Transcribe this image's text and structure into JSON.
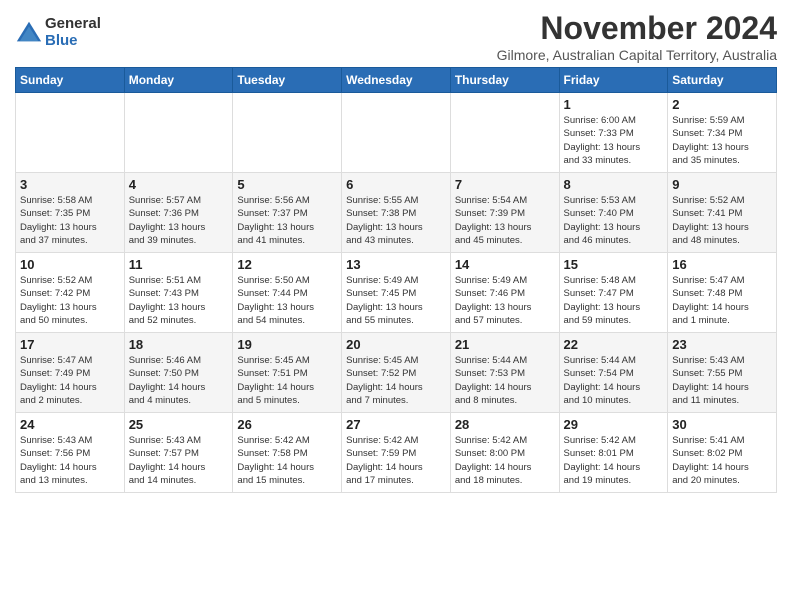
{
  "header": {
    "logo_general": "General",
    "logo_blue": "Blue",
    "month_title": "November 2024",
    "location": "Gilmore, Australian Capital Territory, Australia"
  },
  "days_of_week": [
    "Sunday",
    "Monday",
    "Tuesday",
    "Wednesday",
    "Thursday",
    "Friday",
    "Saturday"
  ],
  "weeks": [
    [
      {
        "day": "",
        "info": ""
      },
      {
        "day": "",
        "info": ""
      },
      {
        "day": "",
        "info": ""
      },
      {
        "day": "",
        "info": ""
      },
      {
        "day": "",
        "info": ""
      },
      {
        "day": "1",
        "info": "Sunrise: 6:00 AM\nSunset: 7:33 PM\nDaylight: 13 hours\nand 33 minutes."
      },
      {
        "day": "2",
        "info": "Sunrise: 5:59 AM\nSunset: 7:34 PM\nDaylight: 13 hours\nand 35 minutes."
      }
    ],
    [
      {
        "day": "3",
        "info": "Sunrise: 5:58 AM\nSunset: 7:35 PM\nDaylight: 13 hours\nand 37 minutes."
      },
      {
        "day": "4",
        "info": "Sunrise: 5:57 AM\nSunset: 7:36 PM\nDaylight: 13 hours\nand 39 minutes."
      },
      {
        "day": "5",
        "info": "Sunrise: 5:56 AM\nSunset: 7:37 PM\nDaylight: 13 hours\nand 41 minutes."
      },
      {
        "day": "6",
        "info": "Sunrise: 5:55 AM\nSunset: 7:38 PM\nDaylight: 13 hours\nand 43 minutes."
      },
      {
        "day": "7",
        "info": "Sunrise: 5:54 AM\nSunset: 7:39 PM\nDaylight: 13 hours\nand 45 minutes."
      },
      {
        "day": "8",
        "info": "Sunrise: 5:53 AM\nSunset: 7:40 PM\nDaylight: 13 hours\nand 46 minutes."
      },
      {
        "day": "9",
        "info": "Sunrise: 5:52 AM\nSunset: 7:41 PM\nDaylight: 13 hours\nand 48 minutes."
      }
    ],
    [
      {
        "day": "10",
        "info": "Sunrise: 5:52 AM\nSunset: 7:42 PM\nDaylight: 13 hours\nand 50 minutes."
      },
      {
        "day": "11",
        "info": "Sunrise: 5:51 AM\nSunset: 7:43 PM\nDaylight: 13 hours\nand 52 minutes."
      },
      {
        "day": "12",
        "info": "Sunrise: 5:50 AM\nSunset: 7:44 PM\nDaylight: 13 hours\nand 54 minutes."
      },
      {
        "day": "13",
        "info": "Sunrise: 5:49 AM\nSunset: 7:45 PM\nDaylight: 13 hours\nand 55 minutes."
      },
      {
        "day": "14",
        "info": "Sunrise: 5:49 AM\nSunset: 7:46 PM\nDaylight: 13 hours\nand 57 minutes."
      },
      {
        "day": "15",
        "info": "Sunrise: 5:48 AM\nSunset: 7:47 PM\nDaylight: 13 hours\nand 59 minutes."
      },
      {
        "day": "16",
        "info": "Sunrise: 5:47 AM\nSunset: 7:48 PM\nDaylight: 14 hours\nand 1 minute."
      }
    ],
    [
      {
        "day": "17",
        "info": "Sunrise: 5:47 AM\nSunset: 7:49 PM\nDaylight: 14 hours\nand 2 minutes."
      },
      {
        "day": "18",
        "info": "Sunrise: 5:46 AM\nSunset: 7:50 PM\nDaylight: 14 hours\nand 4 minutes."
      },
      {
        "day": "19",
        "info": "Sunrise: 5:45 AM\nSunset: 7:51 PM\nDaylight: 14 hours\nand 5 minutes."
      },
      {
        "day": "20",
        "info": "Sunrise: 5:45 AM\nSunset: 7:52 PM\nDaylight: 14 hours\nand 7 minutes."
      },
      {
        "day": "21",
        "info": "Sunrise: 5:44 AM\nSunset: 7:53 PM\nDaylight: 14 hours\nand 8 minutes."
      },
      {
        "day": "22",
        "info": "Sunrise: 5:44 AM\nSunset: 7:54 PM\nDaylight: 14 hours\nand 10 minutes."
      },
      {
        "day": "23",
        "info": "Sunrise: 5:43 AM\nSunset: 7:55 PM\nDaylight: 14 hours\nand 11 minutes."
      }
    ],
    [
      {
        "day": "24",
        "info": "Sunrise: 5:43 AM\nSunset: 7:56 PM\nDaylight: 14 hours\nand 13 minutes."
      },
      {
        "day": "25",
        "info": "Sunrise: 5:43 AM\nSunset: 7:57 PM\nDaylight: 14 hours\nand 14 minutes."
      },
      {
        "day": "26",
        "info": "Sunrise: 5:42 AM\nSunset: 7:58 PM\nDaylight: 14 hours\nand 15 minutes."
      },
      {
        "day": "27",
        "info": "Sunrise: 5:42 AM\nSunset: 7:59 PM\nDaylight: 14 hours\nand 17 minutes."
      },
      {
        "day": "28",
        "info": "Sunrise: 5:42 AM\nSunset: 8:00 PM\nDaylight: 14 hours\nand 18 minutes."
      },
      {
        "day": "29",
        "info": "Sunrise: 5:42 AM\nSunset: 8:01 PM\nDaylight: 14 hours\nand 19 minutes."
      },
      {
        "day": "30",
        "info": "Sunrise: 5:41 AM\nSunset: 8:02 PM\nDaylight: 14 hours\nand 20 minutes."
      }
    ]
  ]
}
